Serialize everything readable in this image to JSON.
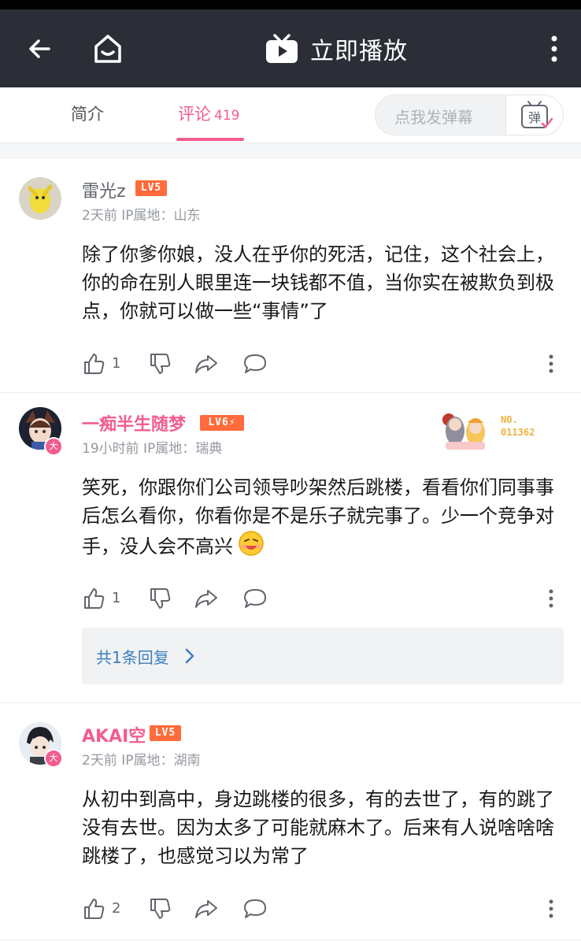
{
  "header": {
    "play_label": "立即播放",
    "icons": [
      "back-arrow-icon",
      "home-icon",
      "tv-play-icon",
      "more-vertical-icon"
    ]
  },
  "tabs": [
    {
      "label": "简介",
      "count": ""
    },
    {
      "label": "评论",
      "count": "419"
    }
  ],
  "danmaku": {
    "placeholder": "点我发弹幕",
    "button_glyph": "弹"
  },
  "colors": {
    "accent": "#f25d8e",
    "header_bg": "#2b2e36",
    "level": "#ff6b3a",
    "link": "#3b7ec1"
  },
  "comments": [
    {
      "username": "雷光z",
      "level": "LV5",
      "meta": "2天前  IP属地：山东",
      "text": "除了你爹你娘，没人在乎你的死活，记住，这个社会上，你的命在别人眼里连一块钱都不值，当你实在被欺负到极点，你就可以做一些“事情”了",
      "likes": "1"
    },
    {
      "username": "一痴半生随梦",
      "level": "LV6⚡",
      "meta": "19小时前  IP属地：瑞典",
      "text": "笑死，你跟你们公司领导吵架然后跳楼，看看你们同事事后怎么看你，你看你是不是乐子就完事了。少一个竞争对手，没人会不高兴",
      "likes": "1",
      "badge": "大",
      "decor_no_label": "NO.",
      "decor_no_value": "011362",
      "replies": "共1条回复"
    },
    {
      "username": "AKAI空",
      "level": "LV5",
      "meta": "2天前  IP属地：湖南",
      "text": "从初中到高中，身边跳楼的很多，有的去世了，有的跳了没有去世。因为太多了可能就麻木了。后来有人说啥啥啥跳楼了，也感觉习以为常了",
      "likes": "2",
      "badge": "大"
    }
  ]
}
